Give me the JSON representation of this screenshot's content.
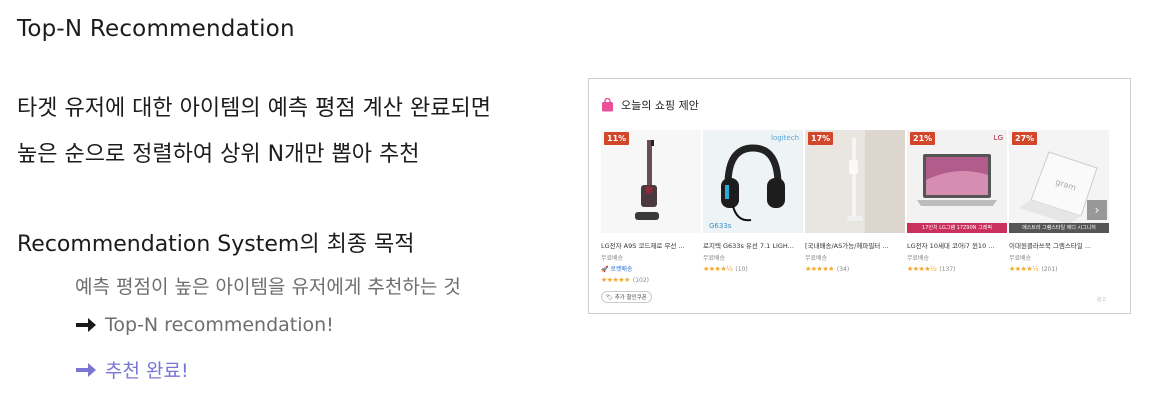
{
  "slide": {
    "title": "Top-N Recommendation",
    "lines": [
      "타겟 유저에 대한 아이템의 예측 평점 계산 완료되면",
      "높은 순으로 정렬하여 상위 N개만 뽑아 추천"
    ],
    "sub_heading": "Recommendation System의 최종 목적",
    "bullets": [
      "예측 평점이 높은 아이템을 유저에게 추천하는 것",
      "Top-N recommendation!",
      "추천 완료!"
    ]
  },
  "colors": {
    "accent_purple": "#7a76d6",
    "discount_badge": "#d2472a",
    "star": "#f5a623"
  },
  "widget": {
    "title": "오늘의 쇼핑 제안",
    "icon": "shopping-bag-icon",
    "next_icon": "chevron-right-icon",
    "footer": "광고",
    "products": [
      {
        "badge": "11%",
        "brand": "",
        "promo": "",
        "name": "LG전자 A9S 코드제로 무선 ...",
        "shipping": "무료배송",
        "rocket": "로켓배송",
        "rating": 5,
        "reviews": "(102)",
        "coupon": "추가 할인쿠폰"
      },
      {
        "badge": "",
        "brand": "logitech",
        "promo": "",
        "name": "로지텍 G633s 유선 7.1 LIGH...",
        "shipping": "무료배송",
        "rocket": "",
        "rating": 4.5,
        "reviews": "(10)",
        "coupon": ""
      },
      {
        "badge": "17%",
        "brand": "",
        "promo": "",
        "name": "[국내배송/AS가능/헤파필터 ...",
        "shipping": "무료배송",
        "rocket": "",
        "rating": 5,
        "reviews": "(34)",
        "coupon": ""
      },
      {
        "badge": "21%",
        "brand": "LG",
        "promo": "17인치 LG그램 17Z90N 그래픽",
        "name": "LG전자 10세대 코어i7 윈10 ...",
        "shipping": "무료배송",
        "rocket": "",
        "rating": 4.5,
        "reviews": "(137)",
        "coupon": ""
      },
      {
        "badge": "27%",
        "brand": "",
        "promo": "에스트라 그램스타일 에디 시그니처",
        "name": "이대원클라쓰북 그램스타일 ...",
        "shipping": "무료배송",
        "rocket": "",
        "rating": 4.5,
        "reviews": "(201)",
        "coupon": ""
      }
    ]
  }
}
